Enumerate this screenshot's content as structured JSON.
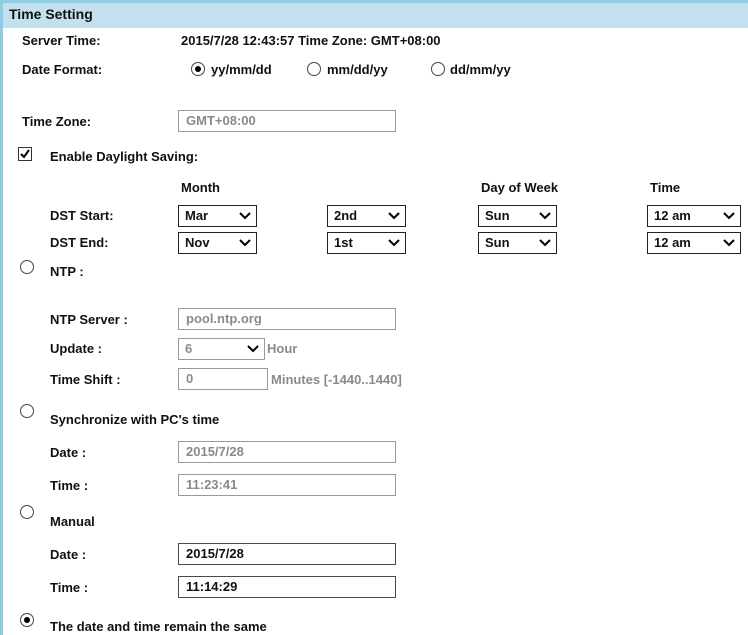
{
  "header": {
    "title": "Time Setting"
  },
  "server_time": {
    "label": "Server Time:",
    "value": "2015/7/28 12:43:57 Time Zone: GMT+08:00"
  },
  "date_format": {
    "label": "Date Format:",
    "options": [
      "yy/mm/dd",
      "mm/dd/yy",
      "dd/mm/yy"
    ],
    "selected": "yy/mm/dd"
  },
  "time_zone": {
    "label": "Time Zone:",
    "value": "GMT+08:00"
  },
  "dst": {
    "enable_label": "Enable Daylight Saving:",
    "checked": true,
    "col_month": "Month",
    "col_day_of_week": "Day of Week",
    "col_time": "Time",
    "start": {
      "label": "DST Start:",
      "month": "Mar",
      "week": "2nd",
      "day": "Sun",
      "time": "12 am"
    },
    "end": {
      "label": "DST End:",
      "month": "Nov",
      "week": "1st",
      "day": "Sun",
      "time": "12 am"
    }
  },
  "ntp": {
    "label": "NTP :",
    "server_label": "NTP Server :",
    "server_value": "pool.ntp.org",
    "update_label": "Update :",
    "update_value": "6",
    "update_unit": "Hour",
    "shift_label": "Time Shift :",
    "shift_value": "0",
    "shift_unit": "Minutes  [-1440..1440]"
  },
  "sync_pc": {
    "label": "Synchronize with PC's time",
    "date_label": "Date :",
    "date_value": "2015/7/28",
    "time_label": "Time :",
    "time_value": "11:23:41"
  },
  "manual": {
    "label": "Manual",
    "date_label": "Date :",
    "date_value": "2015/7/28",
    "time_label": "Time :",
    "time_value": "11:14:29"
  },
  "remain": {
    "label": "The date and time remain the same"
  },
  "selected_mode": "remain"
}
